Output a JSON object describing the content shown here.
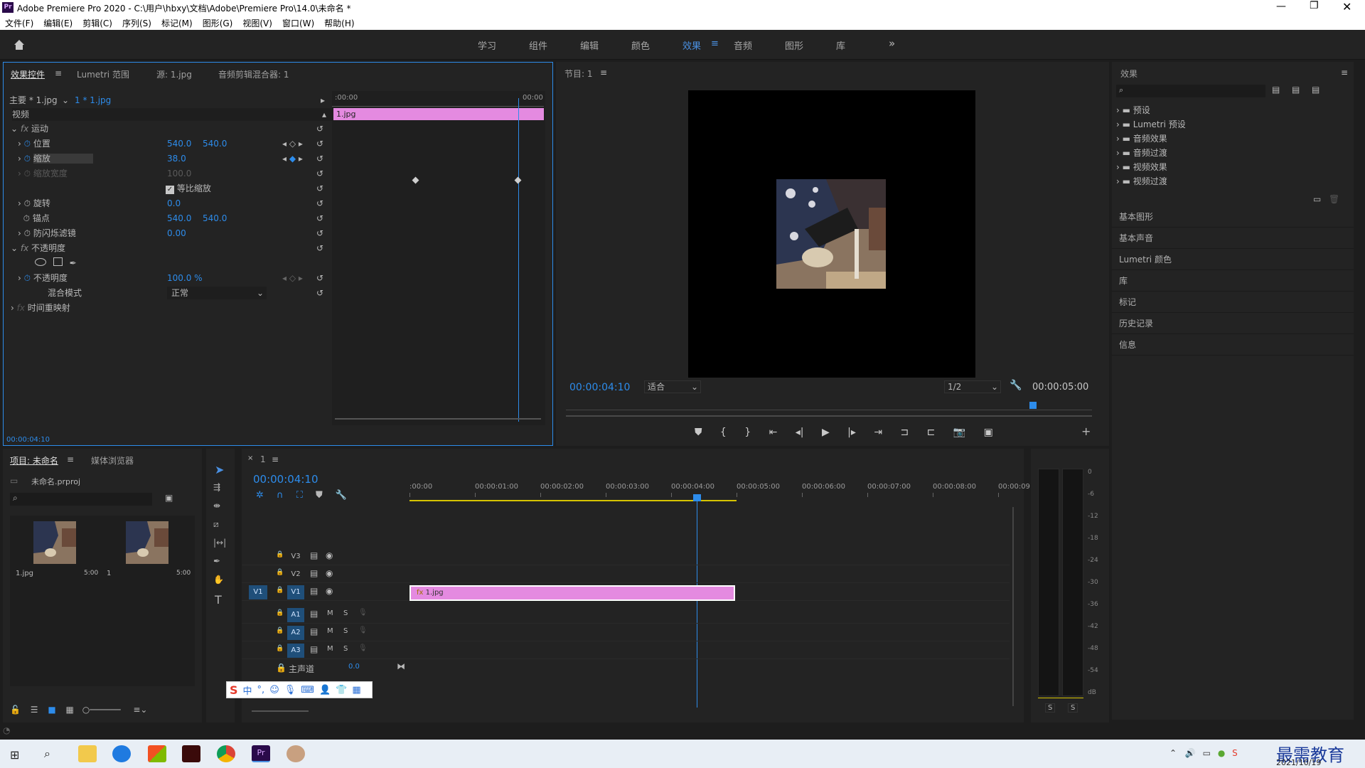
{
  "window": {
    "title": "Adobe Premiere Pro 2020 - C:\\用户\\hbxy\\文档\\Adobe\\Premiere Pro\\14.0\\未命名 *",
    "app_badge": "Pr"
  },
  "menu": [
    "文件(F)",
    "编辑(E)",
    "剪辑(C)",
    "序列(S)",
    "标记(M)",
    "图形(G)",
    "视图(V)",
    "窗口(W)",
    "帮助(H)"
  ],
  "workspaces": {
    "tabs": [
      "学习",
      "组件",
      "编辑",
      "颜色",
      "效果",
      "音频",
      "图形",
      "库"
    ],
    "active": "效果",
    "more": "»"
  },
  "effect_controls": {
    "tabs": [
      "效果控件",
      "Lumetri 范围",
      "源: 1.jpg",
      "音频剪辑混合器: 1"
    ],
    "master": "主要 * 1.jpg",
    "clip": "1 * 1.jpg",
    "section_video": "视频",
    "timecode_start": ":00:00",
    "timecode_end": "00:00",
    "clip_label": "1.jpg",
    "motion": "运动",
    "position_label": "位置",
    "position_x": "540.0",
    "position_y": "540.0",
    "scale_label": "缩放",
    "scale_value": "38.0",
    "scale_width_label": "缩放宽度",
    "scale_width_value": "100.0",
    "uniform_label": "等比缩放",
    "rotation_label": "旋转",
    "rotation_value": "0.0",
    "anchor_label": "锚点",
    "anchor_x": "540.0",
    "anchor_y": "540.0",
    "flicker_label": "防闪烁滤镜",
    "flicker_value": "0.00",
    "opacity_section": "不透明度",
    "opacity_label": "不透明度",
    "opacity_value": "100.0 %",
    "blend_label": "混合模式",
    "blend_value": "正常",
    "time_remap": "时间重映射",
    "footer_time": "00:00:04:10"
  },
  "program": {
    "title": "节目: 1",
    "timecode": "00:00:04:10",
    "fit": "适合",
    "resolution": "1/2",
    "duration": "00:00:05:00"
  },
  "effects_panel": {
    "title": "效果",
    "items": [
      "预设",
      "Lumetri 预设",
      "音频效果",
      "音频过渡",
      "视频效果",
      "视频过渡"
    ],
    "side": [
      "基本图形",
      "基本声音",
      "Lumetri 颜色",
      "库",
      "标记",
      "历史记录",
      "信息"
    ]
  },
  "project": {
    "tabs": [
      "项目: 未命名",
      "媒体浏览器"
    ],
    "file": "未命名.prproj",
    "items": [
      {
        "name": "1.jpg",
        "dur": "5:00"
      },
      {
        "name": "1",
        "dur": "5:00"
      }
    ]
  },
  "timeline": {
    "tab": "1",
    "timecode": "00:00:04:10",
    "ruler": [
      ":00:00",
      "00:00:01:00",
      "00:00:02:00",
      "00:00:03:00",
      "00:00:04:00",
      "00:00:05:00",
      "00:00:06:00",
      "00:00:07:00",
      "00:00:08:00",
      "00:00:09:"
    ],
    "video_tracks": [
      "V3",
      "V2",
      "V1"
    ],
    "audio_tracks": [
      "A1",
      "A2",
      "A3"
    ],
    "src_v": "V1",
    "mix_label": "主声道",
    "mix_value": "0.0",
    "clip_label": "1.jpg",
    "mute": "M",
    "solo": "S",
    "fx_badge": "fx"
  },
  "meter": {
    "scale": [
      "0",
      "-6",
      "-12",
      "-18",
      "-24",
      "-30",
      "-36",
      "-42",
      "-48",
      "-54",
      "dB"
    ],
    "solo": [
      "S",
      "S"
    ]
  },
  "ime": {
    "chars": [
      "中",
      "°,"
    ]
  },
  "taskbar": {
    "date": "2021/10/19",
    "watermark": "最需教育"
  }
}
